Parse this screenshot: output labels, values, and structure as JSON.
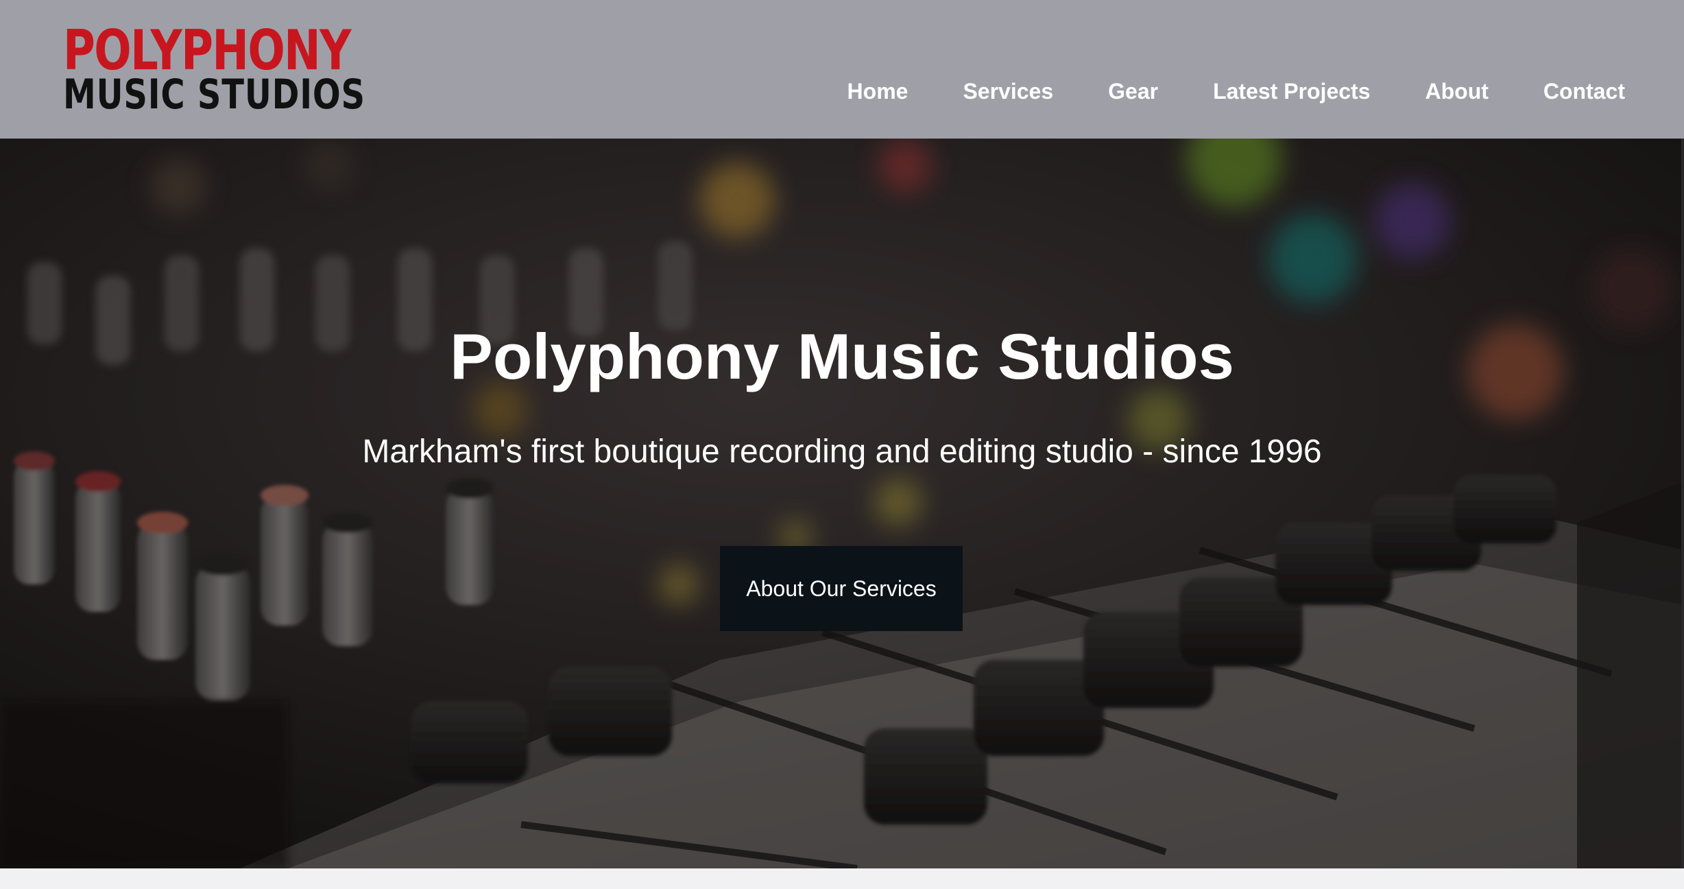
{
  "colors": {
    "header_bg": "#9fa0a7",
    "logo_red": "#c8161f",
    "logo_black": "#111111",
    "cta_bg": "#0b1218",
    "text_light": "#ffffff"
  },
  "header": {
    "logo": {
      "line1": "POLYPHONY",
      "line2": "MUSIC STUDIOS"
    },
    "nav": [
      {
        "label": "Home"
      },
      {
        "label": "Services"
      },
      {
        "label": "Gear"
      },
      {
        "label": "Latest Projects"
      },
      {
        "label": "About"
      },
      {
        "label": "Contact"
      }
    ]
  },
  "hero": {
    "title": "Polyphony Music Studios",
    "subtitle": "Markham's first boutique recording and editing studio - since 1996",
    "cta_label": "About Our Services",
    "background": "mixing-console-photo"
  }
}
